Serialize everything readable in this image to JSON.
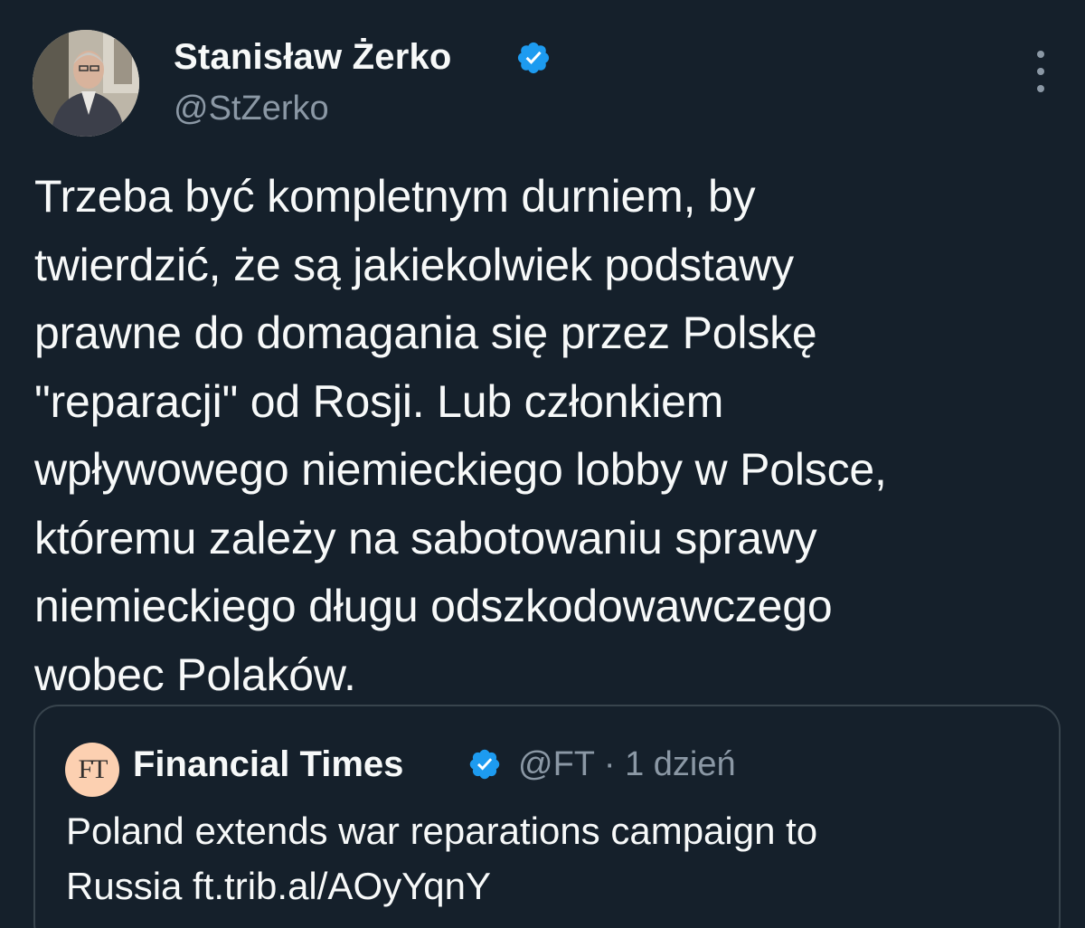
{
  "tweet": {
    "author": {
      "display_name": "Stanisław Żerko",
      "handle": "@StZerko",
      "verified_icon": "verified-badge-icon",
      "avatar": "author-avatar-photo"
    },
    "more_icon": "more-options-icon",
    "text": "Trzeba być kompletnym durniem, by\ntwierdzić, że są jakiekolwiek podstawy\nprawne do domagania się przez Polskę\n\"reparacji\" od Rosji. Lub członkiem\nwpływowego niemieckiego lobby w Polsce,\nktóremu zależy na sabotowaniu sprawy\nniemieckiego długu odszkodowawczego\nwobec Polaków."
  },
  "quote": {
    "avatar_text": "FT",
    "display_name": "Financial Times",
    "meta": "@FT · 1 dzień",
    "verified_icon": "verified-badge-icon",
    "text": "Poland extends war reparations campaign to\nRussia ft.trib.al/AOyYqnY"
  },
  "colors": {
    "background": "#15202b",
    "text_primary": "#f7f9f9",
    "text_secondary": "#8b98a5",
    "verified_blue": "#1d9bf0",
    "border": "#38444d",
    "ft_brand": "#fcd0b1"
  }
}
